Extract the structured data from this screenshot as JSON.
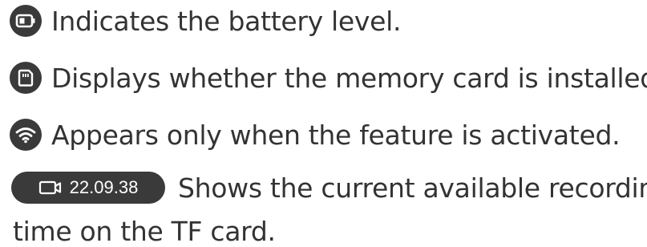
{
  "items": [
    {
      "icon": "battery-icon",
      "text": "Indicates the battery level."
    },
    {
      "icon": "memory-card-icon",
      "text": "Displays whether the memory card is installed."
    },
    {
      "icon": "wifi-icon",
      "text": "Appears only when the feature is activated."
    }
  ],
  "recording": {
    "icon": "video-camera-icon",
    "time": "22.09.38",
    "text_line1": "Shows the current available recording",
    "text_line2": "time on the TF card."
  },
  "colors": {
    "icon_bg": "#3a3a3a",
    "text": "#333333",
    "pill_text": "#ffffff"
  }
}
